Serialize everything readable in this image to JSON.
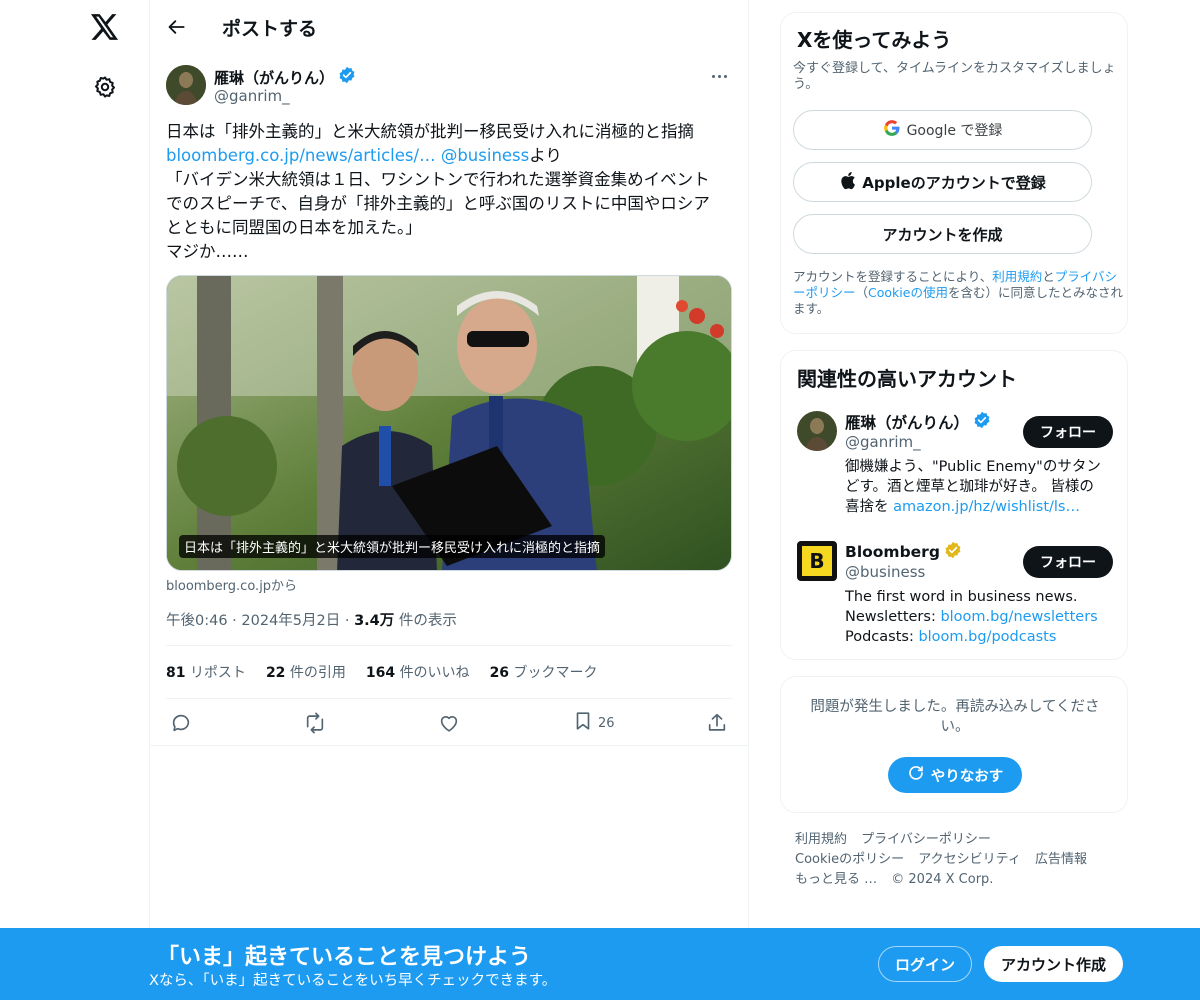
{
  "header": {
    "title": "ポストする"
  },
  "post": {
    "author_name": "雁琳（がんりん）",
    "author_handle": "@ganrim_",
    "text": {
      "line1": "日本は「排外主義的」と米大統領が批判ー移民受け入れに消極的と指摘",
      "link_url": "bloomberg.co.jp/news/articles/…",
      "mention": "@business",
      "suffix": "より",
      "line3": "「バイデン米大統領は１日、ワシントンで行われた選挙資金集めイベント",
      "line4": "でのスピーチで、自身が「排外主義的」と呼ぶ国のリストに中国やロシア",
      "line5": "とともに同盟国の日本を加えた。」",
      "line6": "マジか……"
    },
    "media_caption": "日本は「排外主義的」と米大統領が批判ー移民受け入れに消極的と指摘",
    "source": "bloomberg.co.jpから",
    "time": "午後0:46",
    "date": "2024年5月2日",
    "views_count": "3.4万",
    "views_label": "件の表示",
    "stats": {
      "reposts_count": "81",
      "reposts_label": "リポスト",
      "quotes_count": "22",
      "quotes_label": "件の引用",
      "likes_count": "164",
      "likes_label": "件のいいね",
      "bookmarks_count": "26",
      "bookmarks_label": "ブックマーク"
    },
    "action_bookmark_count": "26"
  },
  "signup": {
    "title": "Xを使ってみよう",
    "subtitle": "今すぐ登録して、タイムラインをカスタマイズしましょう。",
    "google_label": "Google で登録",
    "apple_label": "Appleのアカウントで登録",
    "create_label": "アカウントを作成",
    "legal_prefix": "アカウントを登録することにより、",
    "legal_terms": "利用規約",
    "legal_and": "と",
    "legal_privacy": "プライバシーポリシー",
    "legal_paren_open": "（",
    "legal_cookie": "Cookieの使用",
    "legal_suffix": "を含む）に同意したとみなされます。"
  },
  "related": {
    "title": "関連性の高いアカウント",
    "follow_label": "フォロー",
    "accounts": [
      {
        "name": "雁琳（がんりん）",
        "handle": "@ganrim_",
        "bio1": "御機嫌よう、\"Public Enemy\"のサタン",
        "bio2": "どす。酒と煙草と珈琲が好き。 皆様の",
        "bio3_text": "喜捨を",
        "bio3_link": "amazon.jp/hz/wishlist/ls…"
      },
      {
        "name": "Bloomberg",
        "handle": "@business",
        "avatar_letter": "B",
        "bio1": "The first word in business news.",
        "bio2_text": "Newsletters:",
        "bio2_link": "bloom.bg/newsletters",
        "bio3_text": "Podcasts:",
        "bio3_link": "bloom.bg/podcasts"
      }
    ]
  },
  "error": {
    "message": "問題が発生しました。再読み込みしてください。",
    "retry_label": "やりなおす"
  },
  "footer": {
    "terms": "利用規約",
    "privacy": "プライバシーポリシー",
    "cookie": "Cookieのポリシー",
    "accessibility": "アクセシビリティ",
    "ads": "広告情報",
    "more": "もっと見る …",
    "copyright": "© 2024 X Corp."
  },
  "banner": {
    "title": "「いま」起きていることを見つけよう",
    "subtitle": "Xなら、「いま」起きていることをいち早くチェックできます。",
    "login_label": "ログイン",
    "create_label": "アカウント作成"
  },
  "colors": {
    "accent": "#1d9bf0",
    "verified_blue": "#1d9bf0",
    "verified_gold": "#e2b719",
    "text_primary": "#0f1419",
    "text_secondary": "#536471",
    "bloomberg_avatar_bg": "#f5d81f"
  },
  "icons": {
    "logo": "x-logo-icon",
    "settings": "gear-icon",
    "back": "arrow-left-icon",
    "more": "more-dots-icon",
    "reply": "reply-icon",
    "repost": "repost-icon",
    "like": "heart-icon",
    "bookmark": "bookmark-icon",
    "share": "share-icon",
    "google": "google-icon",
    "apple": "apple-icon",
    "refresh": "refresh-icon"
  }
}
